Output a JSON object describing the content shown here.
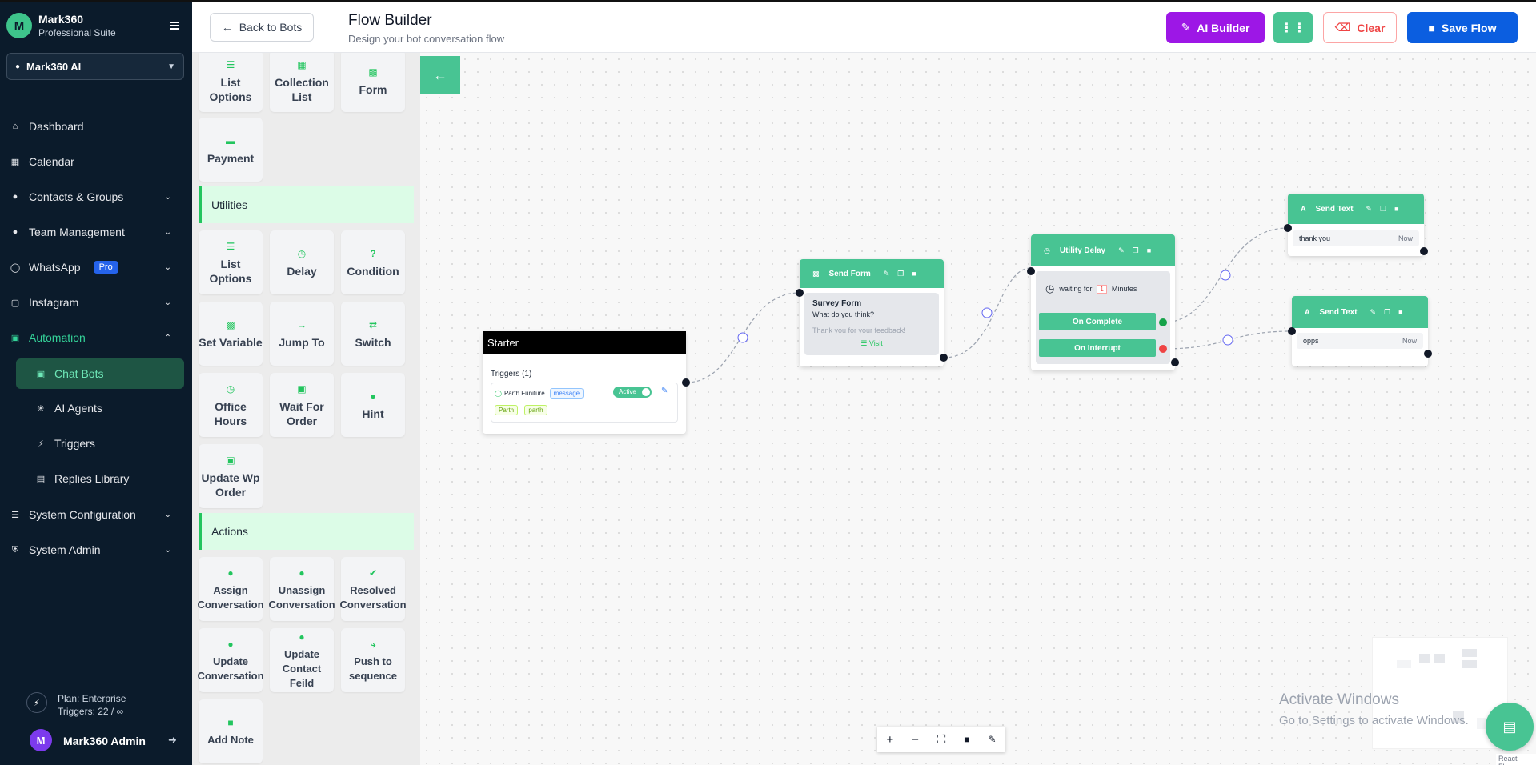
{
  "brand": {
    "name": "Mark360",
    "subtitle": "Professional Suite",
    "logo": "M"
  },
  "workspace": {
    "name": "Mark360 AI"
  },
  "nav": {
    "dashboard": "Dashboard",
    "calendar": "Calendar",
    "contacts": "Contacts & Groups",
    "team": "Team Management",
    "whatsapp": "WhatsApp",
    "whatsapp_badge": "Pro",
    "instagram": "Instagram",
    "automation": "Automation",
    "chatbots": "Chat Bots",
    "ai_agents": "AI Agents",
    "triggers": "Triggers",
    "replies": "Replies Library",
    "sysconfig": "System Configuration",
    "sysadmin": "System Admin"
  },
  "plan": {
    "line1": "Plan: Enterprise",
    "line2": "Triggers: 22 / ∞"
  },
  "user": {
    "name": "Mark360 Admin",
    "initial": "M"
  },
  "header": {
    "back": "Back to Bots",
    "title": "Flow Builder",
    "subtitle": "Design your bot conversation flow",
    "ai_builder": "AI Builder",
    "clear": "Clear",
    "save": "Save Flow"
  },
  "palette": {
    "top": {
      "list_options": "List Options",
      "collection_list": "Collection List",
      "form": "Form",
      "payment": "Payment"
    },
    "utilities_title": "Utilities",
    "utilities": {
      "list_options": "List Options",
      "delay": "Delay",
      "condition": "Condition",
      "set_variable": "Set Variable",
      "jump_to": "Jump To",
      "switch": "Switch",
      "office_hours": "Office Hours",
      "wait_for_order": "Wait For Order",
      "hint": "Hint",
      "update_wp_order": "Update Wp Order"
    },
    "actions_title": "Actions",
    "actions": {
      "assign": "Assign Conversation",
      "unassign": "Unassign Conversation",
      "resolved": "Resolved Conversation",
      "update_conv": "Update Conversation",
      "update_contact": "Update Contact Feild",
      "push_seq": "Push to sequence",
      "add_note": "Add Note"
    }
  },
  "flow": {
    "starter": {
      "title": "Starter",
      "triggers_label": "Triggers (1)",
      "trigger_name": "Parth Funiture",
      "trigger_type": "message",
      "status": "Active",
      "keywords": [
        "Parth",
        "parth"
      ]
    },
    "send_form": {
      "title": "Send Form",
      "form_title": "Survey Form",
      "question": "What do you think?",
      "thanks": "Thank you for your feedback!",
      "button": "Visit"
    },
    "delay": {
      "title": "Utility Delay",
      "waiting": "waiting for",
      "amount": "1",
      "unit": "Minutes",
      "on_complete": "On Complete",
      "on_interrupt": "On Interrupt"
    },
    "text1": {
      "title": "Send Text",
      "message": "thank you",
      "time": "Now"
    },
    "text2": {
      "title": "Send Text",
      "message": "opps",
      "time": "Now"
    }
  },
  "watermark": {
    "line1": "Activate Windows",
    "line2": "Go to Settings to activate Windows."
  },
  "attribution": "React Flow"
}
